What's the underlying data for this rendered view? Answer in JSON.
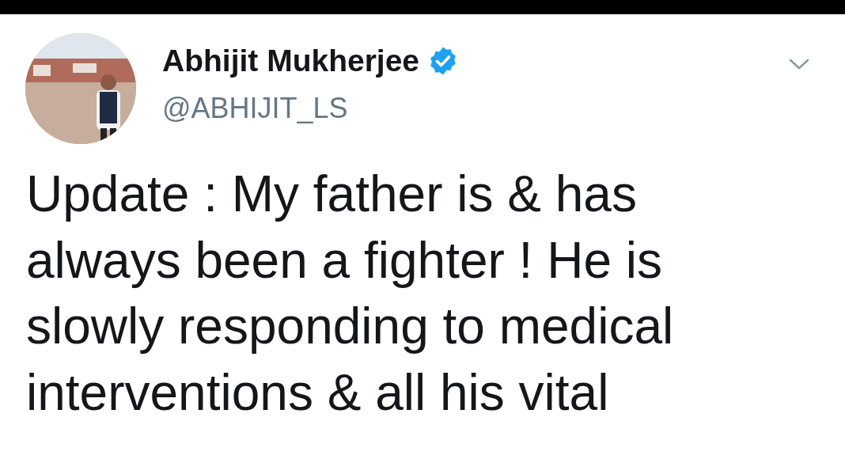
{
  "tweet": {
    "author": {
      "name": "Abhijit Mukherjee",
      "verified": true,
      "handle": "@ABHIJIT_LS"
    },
    "text": "Update : My father is & has always been a fighter ! He is slowly responding to medical interventions & all his vital"
  }
}
